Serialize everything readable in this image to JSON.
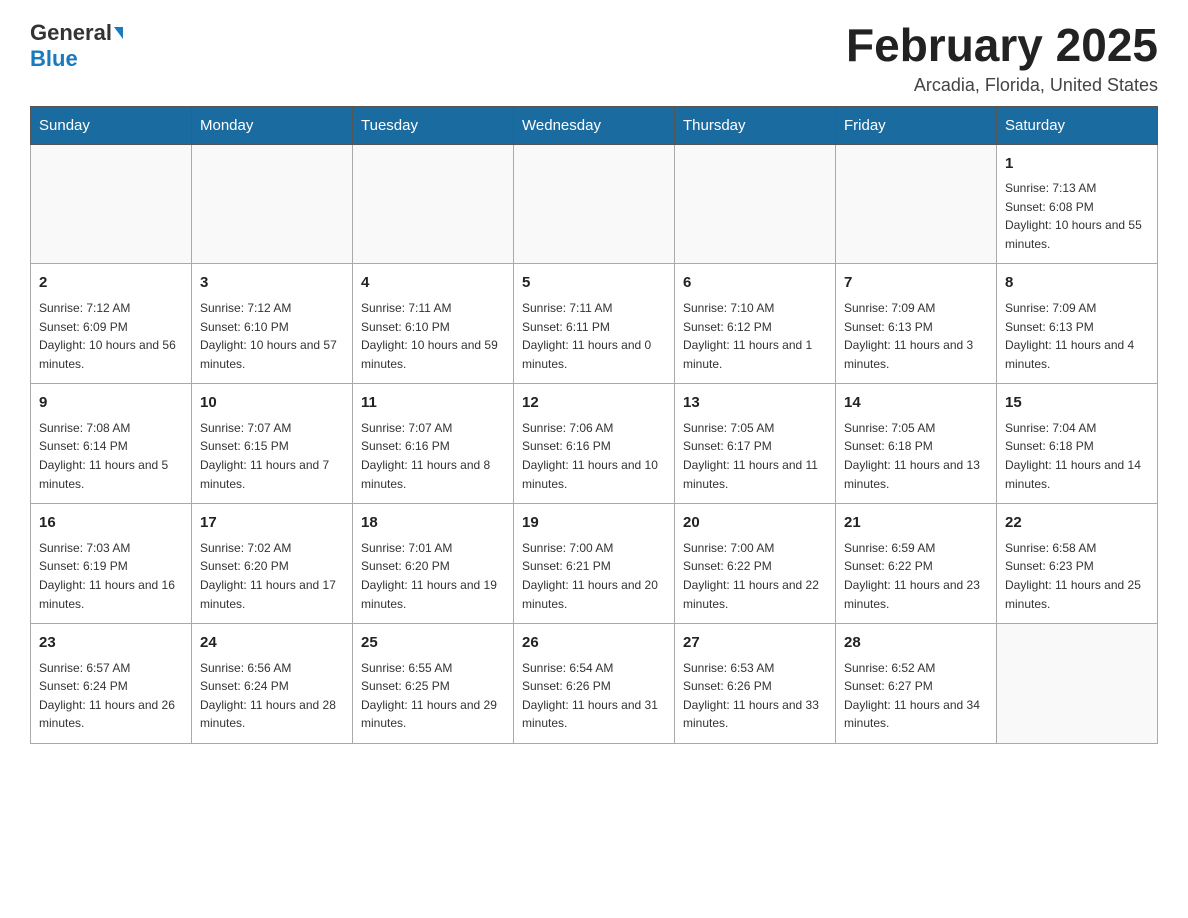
{
  "header": {
    "logo_general": "General",
    "logo_blue": "Blue",
    "month_title": "February 2025",
    "location": "Arcadia, Florida, United States"
  },
  "days_of_week": [
    "Sunday",
    "Monday",
    "Tuesday",
    "Wednesday",
    "Thursday",
    "Friday",
    "Saturday"
  ],
  "weeks": [
    [
      {
        "day": "",
        "sunrise": "",
        "sunset": "",
        "daylight": ""
      },
      {
        "day": "",
        "sunrise": "",
        "sunset": "",
        "daylight": ""
      },
      {
        "day": "",
        "sunrise": "",
        "sunset": "",
        "daylight": ""
      },
      {
        "day": "",
        "sunrise": "",
        "sunset": "",
        "daylight": ""
      },
      {
        "day": "",
        "sunrise": "",
        "sunset": "",
        "daylight": ""
      },
      {
        "day": "",
        "sunrise": "",
        "sunset": "",
        "daylight": ""
      },
      {
        "day": "1",
        "sunrise": "Sunrise: 7:13 AM",
        "sunset": "Sunset: 6:08 PM",
        "daylight": "Daylight: 10 hours and 55 minutes."
      }
    ],
    [
      {
        "day": "2",
        "sunrise": "Sunrise: 7:12 AM",
        "sunset": "Sunset: 6:09 PM",
        "daylight": "Daylight: 10 hours and 56 minutes."
      },
      {
        "day": "3",
        "sunrise": "Sunrise: 7:12 AM",
        "sunset": "Sunset: 6:10 PM",
        "daylight": "Daylight: 10 hours and 57 minutes."
      },
      {
        "day": "4",
        "sunrise": "Sunrise: 7:11 AM",
        "sunset": "Sunset: 6:10 PM",
        "daylight": "Daylight: 10 hours and 59 minutes."
      },
      {
        "day": "5",
        "sunrise": "Sunrise: 7:11 AM",
        "sunset": "Sunset: 6:11 PM",
        "daylight": "Daylight: 11 hours and 0 minutes."
      },
      {
        "day": "6",
        "sunrise": "Sunrise: 7:10 AM",
        "sunset": "Sunset: 6:12 PM",
        "daylight": "Daylight: 11 hours and 1 minute."
      },
      {
        "day": "7",
        "sunrise": "Sunrise: 7:09 AM",
        "sunset": "Sunset: 6:13 PM",
        "daylight": "Daylight: 11 hours and 3 minutes."
      },
      {
        "day": "8",
        "sunrise": "Sunrise: 7:09 AM",
        "sunset": "Sunset: 6:13 PM",
        "daylight": "Daylight: 11 hours and 4 minutes."
      }
    ],
    [
      {
        "day": "9",
        "sunrise": "Sunrise: 7:08 AM",
        "sunset": "Sunset: 6:14 PM",
        "daylight": "Daylight: 11 hours and 5 minutes."
      },
      {
        "day": "10",
        "sunrise": "Sunrise: 7:07 AM",
        "sunset": "Sunset: 6:15 PM",
        "daylight": "Daylight: 11 hours and 7 minutes."
      },
      {
        "day": "11",
        "sunrise": "Sunrise: 7:07 AM",
        "sunset": "Sunset: 6:16 PM",
        "daylight": "Daylight: 11 hours and 8 minutes."
      },
      {
        "day": "12",
        "sunrise": "Sunrise: 7:06 AM",
        "sunset": "Sunset: 6:16 PM",
        "daylight": "Daylight: 11 hours and 10 minutes."
      },
      {
        "day": "13",
        "sunrise": "Sunrise: 7:05 AM",
        "sunset": "Sunset: 6:17 PM",
        "daylight": "Daylight: 11 hours and 11 minutes."
      },
      {
        "day": "14",
        "sunrise": "Sunrise: 7:05 AM",
        "sunset": "Sunset: 6:18 PM",
        "daylight": "Daylight: 11 hours and 13 minutes."
      },
      {
        "day": "15",
        "sunrise": "Sunrise: 7:04 AM",
        "sunset": "Sunset: 6:18 PM",
        "daylight": "Daylight: 11 hours and 14 minutes."
      }
    ],
    [
      {
        "day": "16",
        "sunrise": "Sunrise: 7:03 AM",
        "sunset": "Sunset: 6:19 PM",
        "daylight": "Daylight: 11 hours and 16 minutes."
      },
      {
        "day": "17",
        "sunrise": "Sunrise: 7:02 AM",
        "sunset": "Sunset: 6:20 PM",
        "daylight": "Daylight: 11 hours and 17 minutes."
      },
      {
        "day": "18",
        "sunrise": "Sunrise: 7:01 AM",
        "sunset": "Sunset: 6:20 PM",
        "daylight": "Daylight: 11 hours and 19 minutes."
      },
      {
        "day": "19",
        "sunrise": "Sunrise: 7:00 AM",
        "sunset": "Sunset: 6:21 PM",
        "daylight": "Daylight: 11 hours and 20 minutes."
      },
      {
        "day": "20",
        "sunrise": "Sunrise: 7:00 AM",
        "sunset": "Sunset: 6:22 PM",
        "daylight": "Daylight: 11 hours and 22 minutes."
      },
      {
        "day": "21",
        "sunrise": "Sunrise: 6:59 AM",
        "sunset": "Sunset: 6:22 PM",
        "daylight": "Daylight: 11 hours and 23 minutes."
      },
      {
        "day": "22",
        "sunrise": "Sunrise: 6:58 AM",
        "sunset": "Sunset: 6:23 PM",
        "daylight": "Daylight: 11 hours and 25 minutes."
      }
    ],
    [
      {
        "day": "23",
        "sunrise": "Sunrise: 6:57 AM",
        "sunset": "Sunset: 6:24 PM",
        "daylight": "Daylight: 11 hours and 26 minutes."
      },
      {
        "day": "24",
        "sunrise": "Sunrise: 6:56 AM",
        "sunset": "Sunset: 6:24 PM",
        "daylight": "Daylight: 11 hours and 28 minutes."
      },
      {
        "day": "25",
        "sunrise": "Sunrise: 6:55 AM",
        "sunset": "Sunset: 6:25 PM",
        "daylight": "Daylight: 11 hours and 29 minutes."
      },
      {
        "day": "26",
        "sunrise": "Sunrise: 6:54 AM",
        "sunset": "Sunset: 6:26 PM",
        "daylight": "Daylight: 11 hours and 31 minutes."
      },
      {
        "day": "27",
        "sunrise": "Sunrise: 6:53 AM",
        "sunset": "Sunset: 6:26 PM",
        "daylight": "Daylight: 11 hours and 33 minutes."
      },
      {
        "day": "28",
        "sunrise": "Sunrise: 6:52 AM",
        "sunset": "Sunset: 6:27 PM",
        "daylight": "Daylight: 11 hours and 34 minutes."
      },
      {
        "day": "",
        "sunrise": "",
        "sunset": "",
        "daylight": ""
      }
    ]
  ]
}
